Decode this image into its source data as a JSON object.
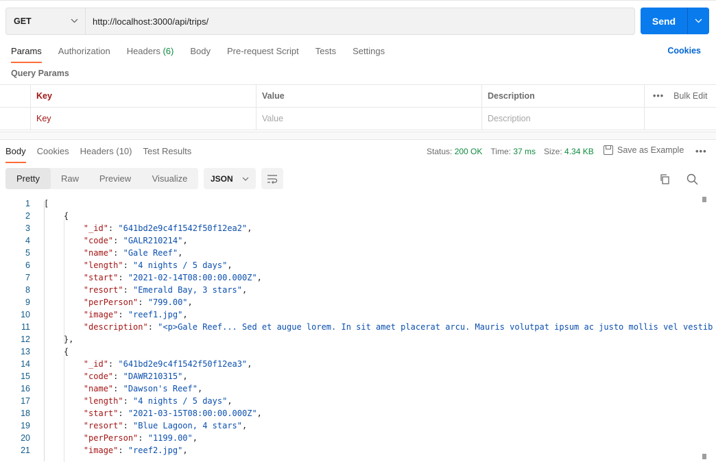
{
  "request": {
    "method": "GET",
    "url": "http://localhost:3000/api/trips/",
    "send_label": "Send"
  },
  "request_tabs": [
    {
      "label": "Params",
      "active": true
    },
    {
      "label": "Authorization"
    },
    {
      "label": "Headers",
      "count": "(6)"
    },
    {
      "label": "Body"
    },
    {
      "label": "Pre-request Script"
    },
    {
      "label": "Tests"
    },
    {
      "label": "Settings"
    }
  ],
  "cookies_label": "Cookies",
  "query_params": {
    "title": "Query Params",
    "headers": {
      "key": "Key",
      "value": "Value",
      "description": "Description",
      "bulk_edit": "Bulk Edit"
    },
    "placeholders": {
      "key": "Key",
      "value": "Value",
      "description": "Description"
    }
  },
  "response_tabs": [
    {
      "label": "Body",
      "active": true
    },
    {
      "label": "Cookies"
    },
    {
      "label": "Headers (10)"
    },
    {
      "label": "Test Results"
    }
  ],
  "response_meta": {
    "status_label": "Status:",
    "status_value": "200 OK",
    "time_label": "Time:",
    "time_value": "37 ms",
    "size_label": "Size:",
    "size_value": "4.34 KB",
    "save_example": "Save as Example"
  },
  "view_modes": [
    "Pretty",
    "Raw",
    "Preview",
    "Visualize"
  ],
  "format": "JSON",
  "colors": {
    "accent": "#097bed",
    "tab_indicator": "#ff6c37",
    "status_ok": "#0f8b3f"
  },
  "code_lines": [
    {
      "n": "1",
      "t": "["
    },
    {
      "n": "2",
      "t": "    {"
    },
    {
      "n": "3",
      "t": "        \"_id\": \"641bd2e9c4f1542f50f12ea2\","
    },
    {
      "n": "4",
      "t": "        \"code\": \"GALR210214\","
    },
    {
      "n": "5",
      "t": "        \"name\": \"Gale Reef\","
    },
    {
      "n": "6",
      "t": "        \"length\": \"4 nights / 5 days\","
    },
    {
      "n": "7",
      "t": "        \"start\": \"2021-02-14T08:00:00.000Z\","
    },
    {
      "n": "8",
      "t": "        \"resort\": \"Emerald Bay, 3 stars\","
    },
    {
      "n": "9",
      "t": "        \"perPerson\": \"799.00\","
    },
    {
      "n": "10",
      "t": "        \"image\": \"reef1.jpg\","
    },
    {
      "n": "11",
      "t": "        \"description\": \"<p>Gale Reef... Sed et augue lorem. In sit amet placerat arcu. Mauris volutpat ipsum ac justo mollis vel vestib"
    },
    {
      "n": "12",
      "t": "    },"
    },
    {
      "n": "13",
      "t": "    {"
    },
    {
      "n": "14",
      "t": "        \"_id\": \"641bd2e9c4f1542f50f12ea3\","
    },
    {
      "n": "15",
      "t": "        \"code\": \"DAWR210315\","
    },
    {
      "n": "16",
      "t": "        \"name\": \"Dawson's Reef\","
    },
    {
      "n": "17",
      "t": "        \"length\": \"4 nights / 5 days\","
    },
    {
      "n": "18",
      "t": "        \"start\": \"2021-03-15T08:00:00.000Z\","
    },
    {
      "n": "19",
      "t": "        \"resort\": \"Blue Lagoon, 4 stars\","
    },
    {
      "n": "20",
      "t": "        \"perPerson\": \"1199.00\","
    },
    {
      "n": "21",
      "t": "        \"image\": \"reef2.jpg\","
    }
  ]
}
